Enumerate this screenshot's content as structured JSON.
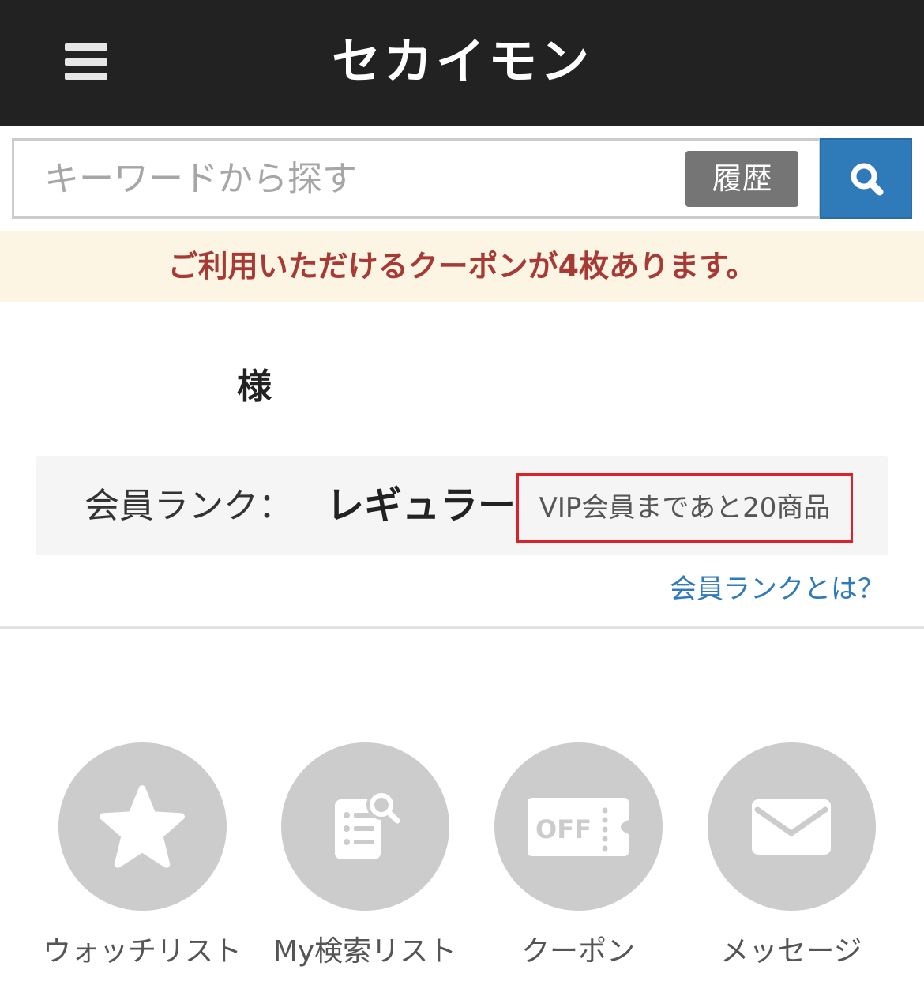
{
  "header": {
    "logo_text": "セカイモン",
    "menu_icon": "hamburger-menu-icon"
  },
  "search": {
    "placeholder": "キーワードから探す",
    "history_label": "履歴",
    "search_icon": "search-icon"
  },
  "coupon_banner": {
    "text": "ご利用いただけるクーポンが4枚あります。",
    "color": "#a83a35",
    "background": "#fcf5e3"
  },
  "user": {
    "name_suffix": "様"
  },
  "membership": {
    "rank_label": "会員ランク：",
    "rank_value": "レギュラー",
    "progress_text": "VIP会員まであと20商品",
    "help_link": "会員ランクとは？"
  },
  "quick_menu": [
    {
      "label": "ウォッチリスト",
      "icon": "star-icon"
    },
    {
      "label": "My検索リスト",
      "icon": "search-list-icon"
    },
    {
      "label": "クーポン",
      "icon": "coupon-off-icon"
    },
    {
      "label": "メッセージ",
      "icon": "envelope-icon"
    }
  ],
  "colors": {
    "header_bg": "#222222",
    "accent_blue": "#2f7ab8",
    "highlight_red": "#d9222a",
    "icon_circle": "#cccccc"
  }
}
